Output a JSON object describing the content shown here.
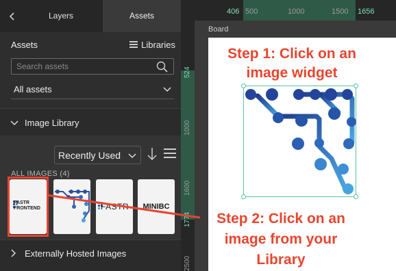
{
  "tabs": {
    "layers": "Layers",
    "assets": "Assets"
  },
  "assets_header": {
    "title": "Assets",
    "libraries_label": "Libraries"
  },
  "search": {
    "placeholder": "Search assets",
    "value": ""
  },
  "filter": {
    "selected": "All assets"
  },
  "image_library": {
    "title": "Image Library",
    "sort": "Recently Used",
    "count_label": "ALL IMAGES",
    "count": "(4)"
  },
  "thumbnails": [
    {
      "label": "FASTR FRONTEND"
    },
    {
      "label": ""
    },
    {
      "label": "FASTR"
    },
    {
      "label": "MINIBC"
    }
  ],
  "external": {
    "title": "Externally Hosted Images"
  },
  "rulers": {
    "h_start_highlight": "406",
    "h_ticks": [
      "500",
      "1000",
      "1500"
    ],
    "h_end_highlight": "1656",
    "v_ticks": [
      "524",
      "1000",
      "1600",
      "1774",
      "2500"
    ]
  },
  "board": {
    "label": "Board"
  },
  "annotations": {
    "step1": "Step 1: Click on an image widget",
    "step2": "Step 2: Click on an image from your Library"
  },
  "colors": {
    "accent_green": "#56c49a",
    "annotation_red": "#e8452f",
    "ruler_highlight": "#2f5a48"
  }
}
